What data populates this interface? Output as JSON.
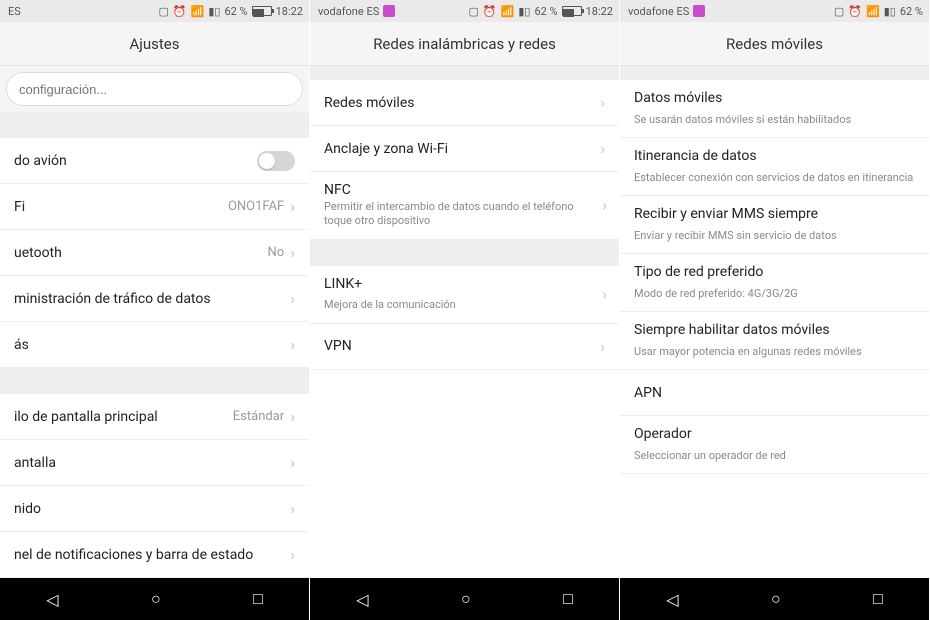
{
  "status": {
    "carrier": "vodafone ES",
    "carrier_short": "ES",
    "battery": "62 %",
    "time": "18:22"
  },
  "p1": {
    "title": "Ajustes",
    "search_placeholder": "configuración...",
    "rows": {
      "airplane": "do avión",
      "wifi": "Fi",
      "wifi_val": "ONO1FAF",
      "bt": "uetooth",
      "bt_val": "No",
      "data": "ministración de tráfico de datos",
      "more": "ás",
      "homestyle": "ilo de pantalla principal",
      "homestyle_val": "Estándar",
      "display": "antalla",
      "sound": "nido",
      "notif": "nel de notificaciones y barra de estado"
    }
  },
  "p2": {
    "title": "Redes inalámbricas y redes",
    "rows": {
      "mobile": "Redes móviles",
      "tether": "Anclaje y zona Wi-Fi",
      "nfc": "NFC",
      "nfc_sub": "Permitir el intercambio de datos cuando el teléfono toque otro dispositivo",
      "link": "LINK+",
      "link_sub": "Mejora de la comunicación",
      "vpn": "VPN"
    }
  },
  "p3": {
    "title": "Redes móviles",
    "rows": {
      "data": "Datos móviles",
      "data_sub": "Se usarán datos móviles si están habilitados",
      "roam": "Itinerancia de datos",
      "roam_sub": "Establecer conexión con servicios de datos en itinerancia",
      "mms": "Recibir y enviar MMS siempre",
      "mms_sub": "Enviar y recibir MMS sin servicio de datos",
      "pref": "Tipo de red preferido",
      "pref_sub": "Modo de red preferido: 4G/3G/2G",
      "always": "Siempre habilitar datos móviles",
      "always_sub": "Usar mayor potencia en algunas redes móviles",
      "apn": "APN",
      "operator": "Operador",
      "operator_sub": "Seleccionar un operador de red"
    }
  }
}
